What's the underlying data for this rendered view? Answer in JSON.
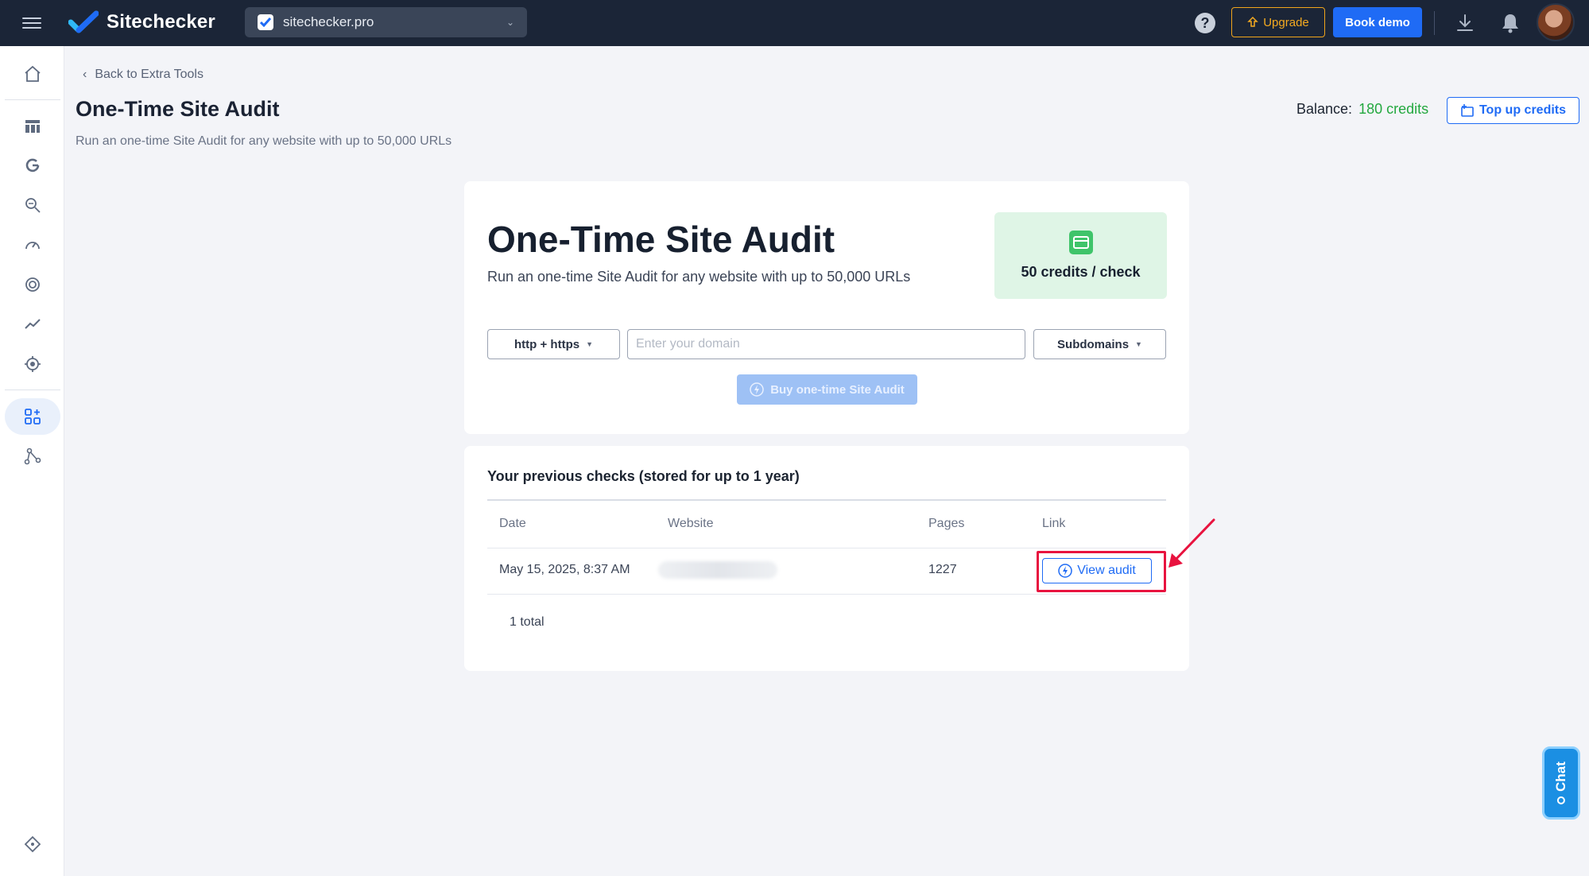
{
  "topbar": {
    "brand": "Sitechecker",
    "project": "sitechecker.pro",
    "upgrade": "Upgrade",
    "book_demo": "Book demo",
    "help": "?"
  },
  "colors": {
    "topbar_bg": "#1b2537",
    "primary": "#1f6bf5",
    "upgrade": "#f0a41b",
    "success": "#23a83f",
    "highlight": "#e8133f"
  },
  "sidebar": {
    "items": [
      {
        "icon": "home-icon"
      },
      {
        "icon": "dashboard-icon"
      },
      {
        "icon": "google-icon"
      },
      {
        "icon": "keyword-search-icon"
      },
      {
        "icon": "speed-icon"
      },
      {
        "icon": "target-icon"
      },
      {
        "icon": "trend-icon"
      },
      {
        "icon": "crosshair-icon"
      },
      {
        "icon": "extra-tools-icon",
        "active": true
      },
      {
        "icon": "network-icon"
      },
      {
        "icon": "diamond-icon"
      }
    ]
  },
  "header": {
    "back": "Back to Extra Tools",
    "title": "One-Time Site Audit",
    "subtitle": "Run an one-time Site Audit for any website with up to 50,000 URLs",
    "balance_label": "Balance:",
    "balance_value": "180 credits",
    "topup": "Top up credits"
  },
  "audit_card": {
    "title": "One-Time Site Audit",
    "subtitle": "Run an one-time Site Audit for any website with up to 50,000 URLs",
    "price": "50 credits / check",
    "protocol": "http + https",
    "domain_placeholder": "Enter your domain",
    "domain_value": "",
    "subdomains": "Subdomains",
    "buy": "Buy one-time Site Audit"
  },
  "previous": {
    "title": "Your previous checks (stored for up to 1 year)",
    "columns": [
      "Date",
      "Website",
      "Pages",
      "Link"
    ],
    "rows": [
      {
        "date": "May 15, 2025, 8:37 AM",
        "website": "",
        "pages": "1227",
        "link": "View audit"
      }
    ],
    "total": "1 total"
  },
  "chat": {
    "label": "Chat"
  }
}
